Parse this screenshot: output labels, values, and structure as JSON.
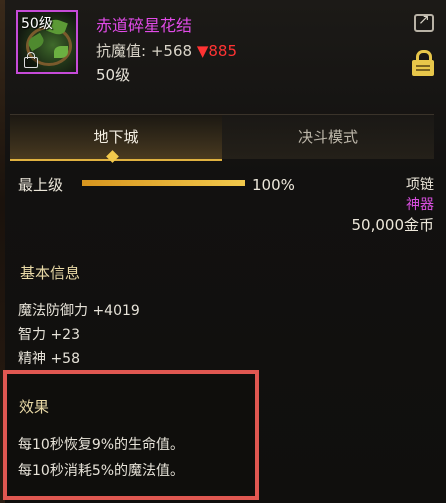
{
  "item": {
    "level_tag": "50级",
    "name": "赤道碎星花结",
    "stat_label": "抗魔值:",
    "stat_plus": "+568",
    "stat_down": "▼885",
    "level": "50级"
  },
  "tabs": [
    {
      "label": "地下城",
      "active": true
    },
    {
      "label": "决斗模式",
      "active": false
    }
  ],
  "upgrade": {
    "label": "最上级",
    "progress": 1.0,
    "progress_text": "100%"
  },
  "meta": {
    "slot": "项链",
    "rarity": "神器",
    "price": "50,000金币"
  },
  "base_info": {
    "title": "基本信息",
    "attributes": [
      "魔法防御力 +4019",
      "智力 +23",
      "精神 +58"
    ]
  },
  "effect": {
    "title": "效果",
    "lines": [
      "每10秒恢复9%的生命值。",
      "每10秒消耗5%的魔法值。"
    ]
  },
  "colors": {
    "name": "#e24be8",
    "rarity": "#d94fe0",
    "highlight_border": "#e05751",
    "progress": "#f2c94c"
  },
  "icons": [
    "share-icon",
    "lock-icon"
  ]
}
